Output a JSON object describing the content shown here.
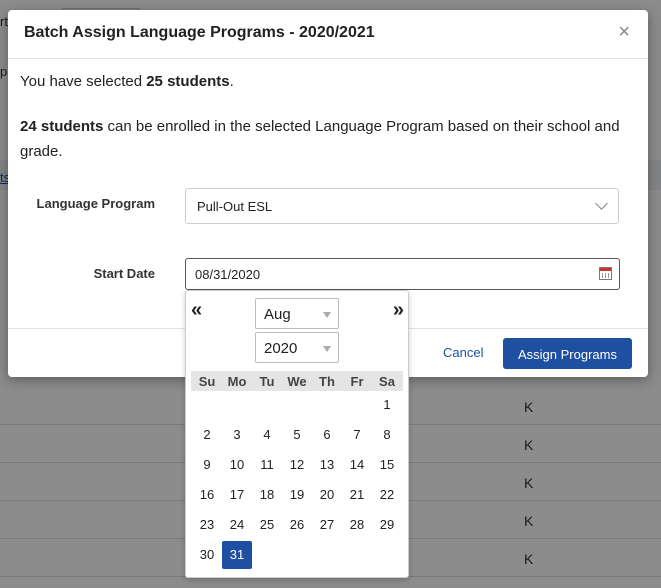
{
  "modal": {
    "title": "Batch Assign Language Programs - 2020/2021",
    "close_glyph": "×",
    "selected_prefix": "You have selected ",
    "selected_count": "25 students",
    "selected_suffix": ".",
    "enroll_count": "24 students",
    "enroll_text": " can be enrolled in the selected Language Program based on their school and grade.",
    "language_program_label": "Language Program",
    "language_program_value": "Pull-Out ESL",
    "start_date_label": "Start Date",
    "start_date_value": "08/31/2020",
    "cancel_label": "Cancel",
    "assign_label": "Assign Programs"
  },
  "calendar": {
    "prev_glyph": "«",
    "next_glyph": "»",
    "month": "Aug",
    "year": "2020",
    "weekdays": [
      "Su",
      "Mo",
      "Tu",
      "We",
      "Th",
      "Fr",
      "Sa"
    ],
    "days": [
      "1",
      "2",
      "3",
      "4",
      "5",
      "6",
      "7",
      "8",
      "9",
      "10",
      "11",
      "12",
      "13",
      "14",
      "15",
      "16",
      "17",
      "18",
      "19",
      "20",
      "21",
      "22",
      "23",
      "24",
      "25",
      "26",
      "27",
      "28",
      "29",
      "30",
      "31"
    ],
    "first_weekday_index": 6,
    "selected_day": "31"
  },
  "background": {
    "frag_top": "rt",
    "frag_mid": "p",
    "frag_link": "ts",
    "grade_values": [
      "K",
      "K",
      "K",
      "K",
      "K"
    ]
  },
  "colors": {
    "accent": "#1e4fa0"
  }
}
